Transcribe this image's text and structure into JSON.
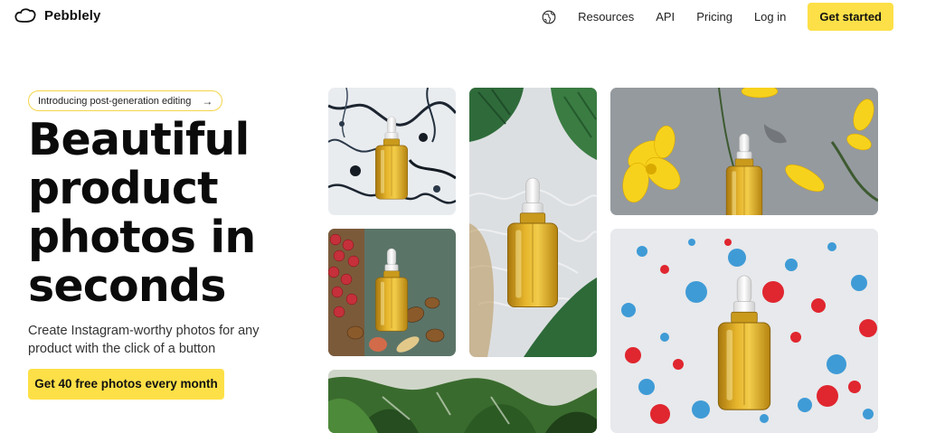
{
  "nav": {
    "brand": "Pebblely",
    "links": [
      "Resources",
      "API",
      "Pricing",
      "Log in"
    ],
    "cta": "Get started"
  },
  "hero": {
    "announcement": "Introducing post-generation editing",
    "announcement_arrow": "→",
    "title": "Beautiful product photos in seconds",
    "subtitle": "Create Instagram-worthy photos for any product with the click of a button",
    "cta": "Get 40 free photos every month"
  },
  "gallery": [
    {
      "scene": "black-white-marble",
      "subject": "serum-dropper-bottle"
    },
    {
      "scene": "monstera-leaves-water",
      "subject": "serum-dropper-bottle"
    },
    {
      "scene": "grey-stone-yellow-flowers",
      "subject": "serum-dropper-bottle"
    },
    {
      "scene": "berries-nuts-green-board",
      "subject": "serum-dropper-bottle"
    },
    {
      "scene": "red-blue-paint-splatter",
      "subject": "serum-dropper-bottle"
    },
    {
      "scene": "green-leaves",
      "subject": "plants"
    }
  ],
  "colors": {
    "accent": "#fde047",
    "pill_border": "#f4d54a",
    "text": "#111111",
    "oil": "#d4a521"
  }
}
